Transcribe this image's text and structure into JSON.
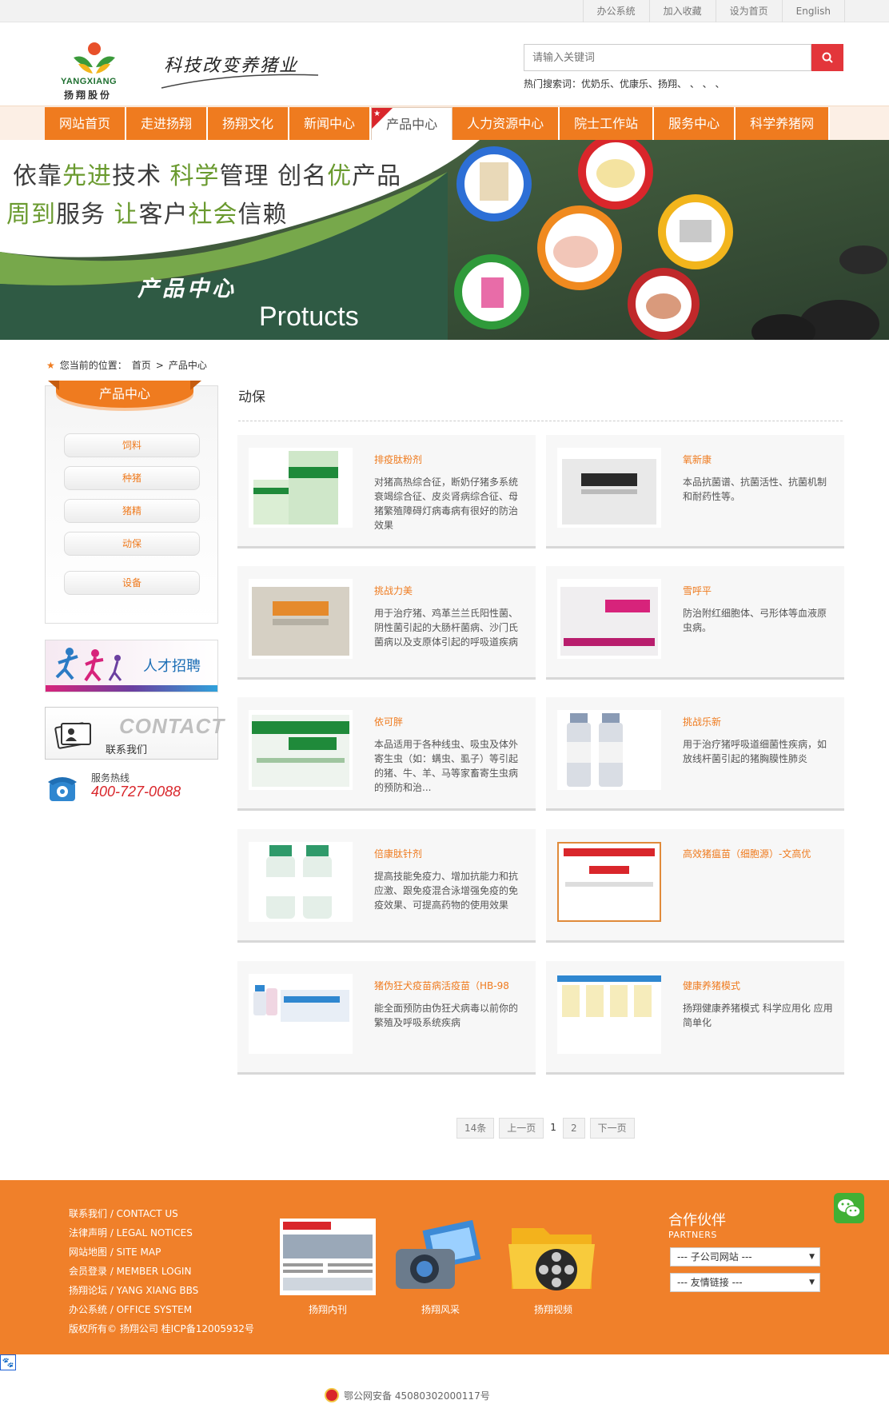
{
  "topbar": {
    "links": [
      "办公系统",
      "加入收藏",
      "设为首页",
      "English"
    ]
  },
  "header": {
    "logo_en": "YANGXIANG",
    "logo_cn": "扬翔股份",
    "slogan": "科技改变养猪业",
    "search_placeholder": "请输入关键词",
    "search_icon": "search-icon",
    "hot_searches": "热门搜索词：优奶乐、优康乐、扬翔、 、 、 、"
  },
  "nav": {
    "items": [
      "网站首页",
      "走进扬翔",
      "扬翔文化",
      "新闻中心",
      "产品中心",
      "人力资源中心",
      "院士工作站",
      "服务中心",
      "科学养猪网"
    ],
    "active": "产品中心"
  },
  "banner": {
    "line1_a": "依靠",
    "line1_b": "先进",
    "line1_c": "技术  ",
    "line1_d": "科学",
    "line1_e": "管理  创名",
    "line1_f": "优",
    "line1_g": "产品",
    "line2_a": "周到",
    "line2_b": "服务  ",
    "line2_c": "让",
    "line2_d": "客户",
    "line2_e": "社会",
    "line2_f": "信赖",
    "title_cn": "产品中心",
    "title_en": "Protucts"
  },
  "breadcrumb": {
    "prefix": "您当前的位置：",
    "home": "首页",
    "sep": ">",
    "current": "产品中心"
  },
  "sidebar": {
    "title": "产品中心",
    "items": [
      "饲料",
      "种猪",
      "猪精",
      "动保",
      "设备"
    ],
    "recruit": "人才招聘",
    "contact_big": "CONTACT",
    "contact_small": "联系我们",
    "hotline_label": "服务热线",
    "hotline_number": "400-727-0088"
  },
  "main": {
    "title": "动保",
    "products": [
      {
        "name": "排疫肽粉剂",
        "desc": "对猪高热综合征，断奶仔猪多系统衰竭综合征、皮炎肾病综合征、母猪繁殖障碍灯病毒病有很好的防治效果"
      },
      {
        "name": "氧新康",
        "desc": "本品抗菌谱、抗菌活性、抗菌机制和耐药性等。"
      },
      {
        "name": "挑战力美",
        "desc": "用于治疗猪、鸡革兰兰氏阳性菌、阴性菌引起的大肠杆菌病、沙门氏菌病以及支原体引起的呼吸道疾病"
      },
      {
        "name": "雪呼平",
        "desc": "防治附红细胞体、弓形体等血液原虫病。"
      },
      {
        "name": "依可胖",
        "desc": "本品适用于各种线虫、吸虫及体外寄生虫（如：螨虫、虱子）等引起的猪、牛、羊、马等家畜寄生虫病的预防和治..."
      },
      {
        "name": "挑战乐新",
        "desc": "用于治疗猪呼吸道细菌性疾病，如放线杆菌引起的猪胸膜性肺炎"
      },
      {
        "name": "倍康肽针剂",
        "desc": "提高技能免疫力、增加抗能力和抗应激、跟免疫混合泳增强免疫的免疫效果、可提高药物的使用效果"
      },
      {
        "name": "高效猪瘟苗（细胞源）-文高优",
        "desc": ""
      },
      {
        "name": "猪伪狂犬疫苗病活疫苗（HB-98",
        "desc": "能全面预防由伪狂犬病毒以前你的繁殖及呼吸系统疾病"
      },
      {
        "name": "健康养猪模式",
        "desc": "扬翔健康养猪模式 科学应用化 应用简单化"
      }
    ]
  },
  "pager": {
    "total": "14条",
    "prev": "上一页",
    "pages": [
      "1",
      "2"
    ],
    "current": "1",
    "next": "下一页"
  },
  "footer": {
    "links": [
      "联系我们 / CONTACT US",
      "法律声明 / LEGAL NOTICES",
      "网站地图 / SITE MAP",
      "会员登录 / MEMBER LOGIN",
      "扬翔论坛 / YANG XIANG BBS",
      "办公系统 / OFFICE SYSTEM",
      "版权所有© 扬翔公司 桂ICP备12005932号"
    ],
    "thumbs": [
      "扬翔内刊",
      "扬翔风采",
      "扬翔视频"
    ],
    "partners_cn": "合作伙伴",
    "partners_en": "PARTNERS",
    "select1": "--- 子公司网站 ---",
    "select2": "--- 友情链接 ---",
    "beian": "鄂公网安备 45080302000117号"
  },
  "colors": {
    "brand_orange": "#ef7b1f",
    "footer_orange": "#f0802a",
    "accent_red": "#e3363b",
    "brand_green": "#1d6f2f"
  }
}
